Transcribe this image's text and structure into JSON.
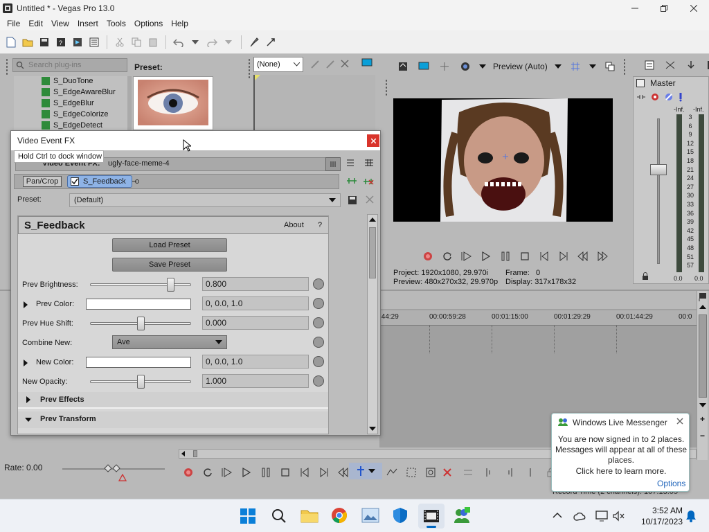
{
  "window": {
    "title": "Untitled * - Vegas Pro 13.0"
  },
  "menu": {
    "items": [
      "File",
      "Edit",
      "View",
      "Insert",
      "Tools",
      "Options",
      "Help"
    ]
  },
  "plugins": {
    "search_placeholder": "Search plug-ins",
    "items": [
      "S_DuoTone",
      "S_EdgeAwareBlur",
      "S_EdgeBlur",
      "S_EdgeColorize",
      "S_EdgeDetect"
    ],
    "preset_label": "Preset:"
  },
  "transitions": {
    "dropdown": "(None)"
  },
  "preview": {
    "mode": "Preview (Auto)",
    "project_label": "Project:",
    "project_value": "1920x1080, 29.970i",
    "frame_label": "Frame:",
    "frame_value": "0",
    "preview_label": "Preview:",
    "preview_value": "480x270x32, 29.970p",
    "display_label": "Display:",
    "display_value": "317x178x32"
  },
  "master": {
    "label": "Master",
    "inf_left": "-Inf.",
    "inf_right": "-Inf.",
    "scale": [
      "3",
      "6",
      "9",
      "12",
      "15",
      "18",
      "21",
      "24",
      "27",
      "30",
      "33",
      "36",
      "39",
      "42",
      "45",
      "48",
      "51",
      "57"
    ],
    "out_left": "0.0",
    "out_right": "0.0"
  },
  "timeline": {
    "ticks": [
      ":44:29",
      "00:00:59:28",
      "00:01:15:00",
      "00:01:29:29",
      "00:01:44:29",
      "00:0"
    ],
    "rate": "Rate: 0.00",
    "record_time": "Record Time (2 channels): 107:13:05"
  },
  "fx_window": {
    "title": "Video Event FX",
    "tooltip": "Hold Ctrl to dock window",
    "event_label": "Video Event FX:",
    "event_value": "ugly-face-meme-4",
    "chain": [
      "Pan/Crop",
      "S_Feedback"
    ],
    "preset_label": "Preset:",
    "preset_value": "(Default)",
    "plugin_title": "S_Feedback",
    "about": "About",
    "help": "?",
    "load_preset": "Load Preset",
    "save_preset": "Save Preset",
    "params": {
      "prev_brightness": {
        "label": "Prev Brightness:",
        "value": "0.800",
        "slider": 0.8
      },
      "prev_color": {
        "label": "Prev Color:",
        "value": "0, 0.0, 1.0"
      },
      "prev_hue": {
        "label": "Prev Hue Shift:",
        "value": "0.000",
        "slider": 0.5
      },
      "combine_new": {
        "label": "Combine New:",
        "value": "Ave"
      },
      "new_color": {
        "label": "New Color:",
        "value": "0, 0.0, 1.0"
      },
      "new_opacity": {
        "label": "New Opacity:",
        "value": "1.000",
        "slider": 0.5
      }
    },
    "sections": [
      "Prev Effects",
      "Prev Transform"
    ]
  },
  "messenger": {
    "title": "Windows Live Messenger",
    "message": "You are now signed in to 2 places. Messages will appear at all of these places.",
    "learn_more": "Click here to learn more.",
    "options": "Options"
  },
  "taskbar": {
    "time": "3:52 AM",
    "date": "10/17/2023"
  },
  "colors": {
    "accent": "#0067c0",
    "workspace": "#b9b9b9",
    "preview_bg": "#000000"
  }
}
